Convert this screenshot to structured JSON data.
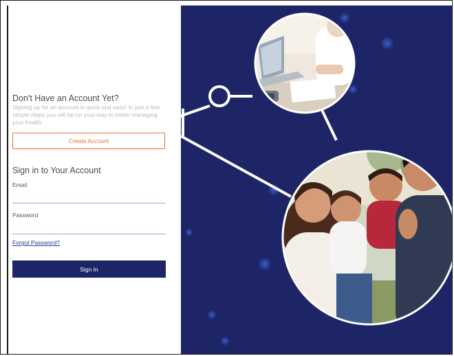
{
  "signup": {
    "heading": "Don't Have an Account Yet?",
    "description": "Signing up for an account is quick and easy! In just a few simple steps you will be on your way to better managing your health.",
    "create_label": "Create Account"
  },
  "signin": {
    "heading": "Sign in to Your Account",
    "email_label": "Email",
    "email_value": "",
    "password_label": "Password",
    "password_value": "",
    "forgot_label": "Forgot Password?",
    "submit_label": "Sign In"
  },
  "theme": {
    "navy": "#1d2567",
    "accent": "#ef6a3a",
    "link": "#2b3a8e"
  },
  "illustrations": {
    "top_circle": "doctor-consultation-photo",
    "main_circle": "family-photo"
  }
}
